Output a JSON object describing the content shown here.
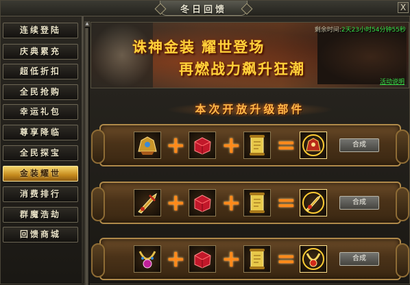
{
  "window": {
    "title": "冬日回馈",
    "close_symbol": "X"
  },
  "sidebar": {
    "items": [
      {
        "label": "连续登陆",
        "active": false
      },
      {
        "label": "庆典累充",
        "active": false
      },
      {
        "label": "超低折扣",
        "active": false
      },
      {
        "label": "全民抢购",
        "active": false
      },
      {
        "label": "幸运礼包",
        "active": false
      },
      {
        "label": "尊享降临",
        "active": false
      },
      {
        "label": "全民探宝",
        "active": false
      },
      {
        "label": "金装耀世",
        "active": true
      },
      {
        "label": "消费排行",
        "active": false
      },
      {
        "label": "群魔浩劫",
        "active": false
      },
      {
        "label": "回馈商城",
        "active": false
      }
    ]
  },
  "banner": {
    "slogan_line1": "诛神金装  耀世登场",
    "slogan_line2": "再燃战力飙升狂潮",
    "timer_label": "剩余时间:",
    "timer_value": "2天23小时54分钟55秒",
    "rules_link": "活动说明"
  },
  "section": {
    "title": "本次开放升级部件"
  },
  "recipes": [
    {
      "inputs": [
        "golden-helmet-icon",
        "red-gem-icon",
        "golden-scroll-icon"
      ],
      "result": "upgraded-helmet-icon",
      "button_label": "合成"
    },
    {
      "inputs": [
        "golden-weapon-icon",
        "red-gem-icon",
        "golden-scroll-icon"
      ],
      "result": "upgraded-weapon-icon",
      "button_label": "合成"
    },
    {
      "inputs": [
        "golden-necklace-icon",
        "red-gem-icon",
        "golden-scroll-icon"
      ],
      "result": "upgraded-necklace-icon",
      "button_label": "合成"
    }
  ],
  "colors": {
    "accent_gold": "#ffd23a",
    "active_tab": "#e6b13f",
    "timer_green": "#38e24a",
    "operator_orange": "#ff8a1a"
  }
}
